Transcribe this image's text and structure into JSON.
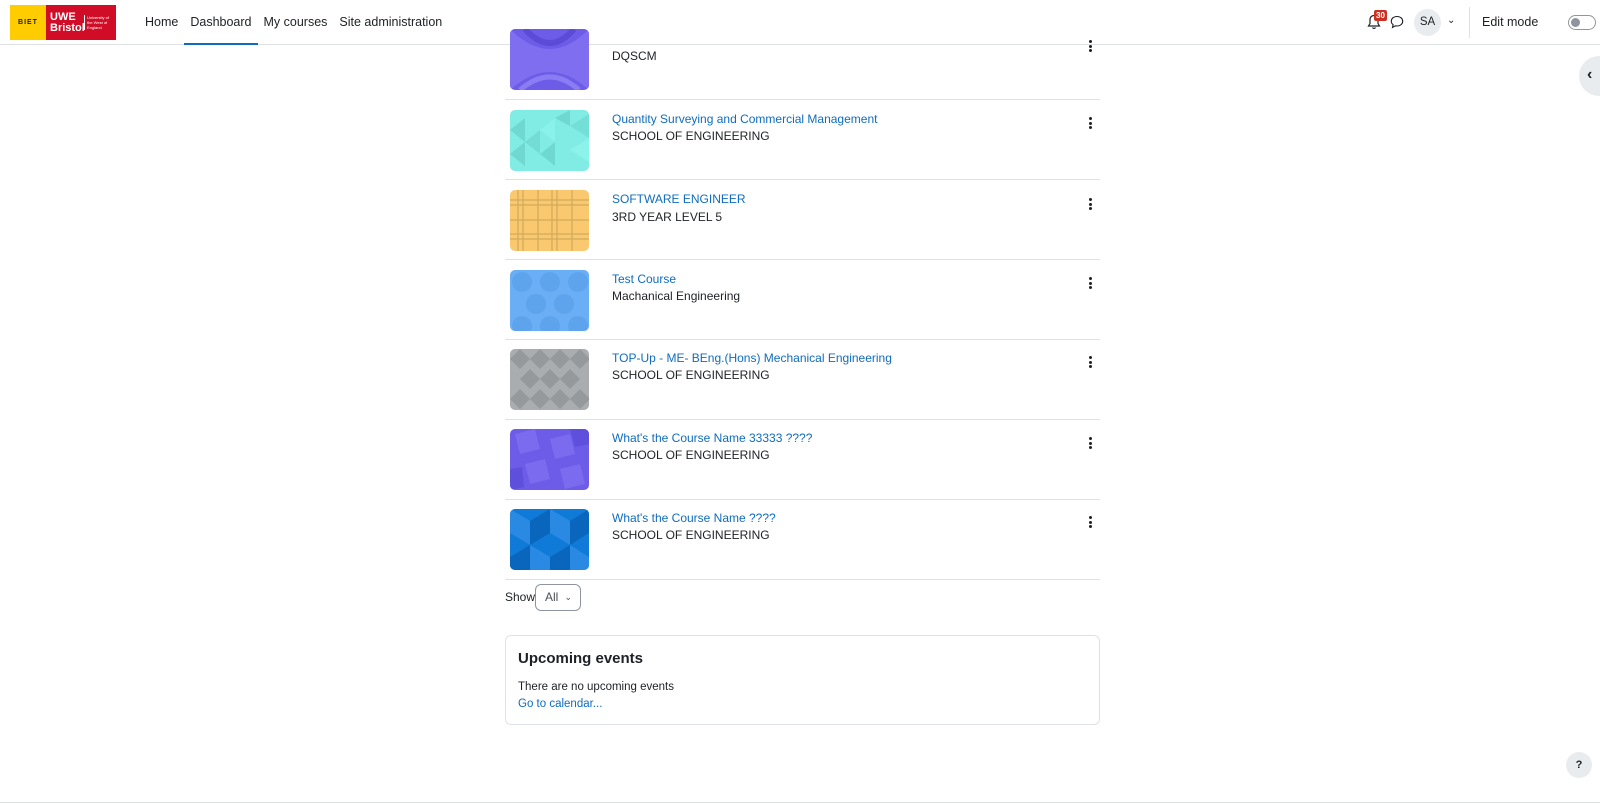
{
  "brand": {
    "biet": "BIET",
    "uwe": "UWE Bristol",
    "uwe_sub": "University of the West of England"
  },
  "nav": {
    "links": [
      "Home",
      "Dashboard",
      "My courses",
      "Site administration"
    ],
    "active": "Dashboard",
    "notifications_count": "30",
    "avatar_initials": "SA",
    "edit_mode_label": "Edit mode"
  },
  "courses": [
    {
      "name": "",
      "category": "DQSCM",
      "pattern": "purple-wave",
      "color": "#6d5ce8"
    },
    {
      "name": "Quantity Surveying and Commercial Management",
      "category": "SCHOOL OF ENGINEERING",
      "pattern": "triangles",
      "color": "#81ece3"
    },
    {
      "name": "SOFTWARE ENGINEER",
      "category": "3RD YEAR LEVEL 5",
      "pattern": "plaid",
      "color": "#f9c86f"
    },
    {
      "name": "Test Course",
      "category": "Machanical Engineering",
      "pattern": "circles",
      "color": "#6aaff5"
    },
    {
      "name": "TOP-Up - ME- BEng.(Hons) Mechanical Engineering",
      "category": "SCHOOL OF ENGINEERING",
      "pattern": "diamonds",
      "color": "#a9adaf"
    },
    {
      "name": "What's the Course Name 33333 ????",
      "category": "SCHOOL OF ENGINEERING",
      "pattern": "squares",
      "color": "#6d5ce8"
    },
    {
      "name": "What's the Course Name ????",
      "category": "SCHOOL OF ENGINEERING",
      "pattern": "hexagons",
      "color": "#0f7ad8"
    }
  ],
  "paging": {
    "show_label": "Show",
    "selected": "All"
  },
  "events": {
    "title": "Upcoming events",
    "empty_text": "There are no upcoming events",
    "calendar_link": "Go to calendar..."
  },
  "help_label": "?"
}
